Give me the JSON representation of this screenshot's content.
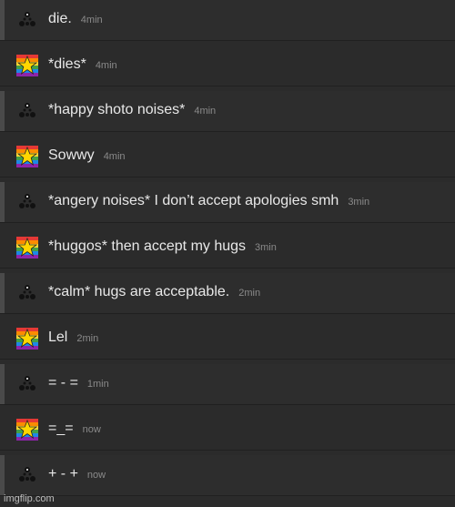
{
  "messages": [
    {
      "text": "die.",
      "time": "4min",
      "avatar": "triangle-dots-icon"
    },
    {
      "text": "*dies*",
      "time": "4min",
      "avatar": "rainbow-star-icon"
    },
    {
      "text": "*happy shoto noises*",
      "time": "4min",
      "avatar": "triangle-dots-icon"
    },
    {
      "text": "Sowwy",
      "time": "4min",
      "avatar": "rainbow-star-icon"
    },
    {
      "text": "*angery noises* I don’t accept apologies smh",
      "time": "3min",
      "avatar": "triangle-dots-icon"
    },
    {
      "text": "*huggos* then accept my hugs",
      "time": "3min",
      "avatar": "rainbow-star-icon"
    },
    {
      "text": "*calm* hugs are acceptable.",
      "time": "2min",
      "avatar": "triangle-dots-icon"
    },
    {
      "text": "Lel",
      "time": "2min",
      "avatar": "rainbow-star-icon"
    },
    {
      "text": "= - =",
      "time": "1min",
      "avatar": "triangle-dots-icon"
    },
    {
      "text": "=_=",
      "time": "now",
      "avatar": "rainbow-star-icon"
    },
    {
      "text": "+ - +",
      "time": "now",
      "avatar": "triangle-dots-icon"
    }
  ],
  "watermark": "imgflip.com",
  "colors": {
    "background": "#2b2b2b",
    "text": "#e8e8e8",
    "timestamp": "#8a8a8a"
  }
}
